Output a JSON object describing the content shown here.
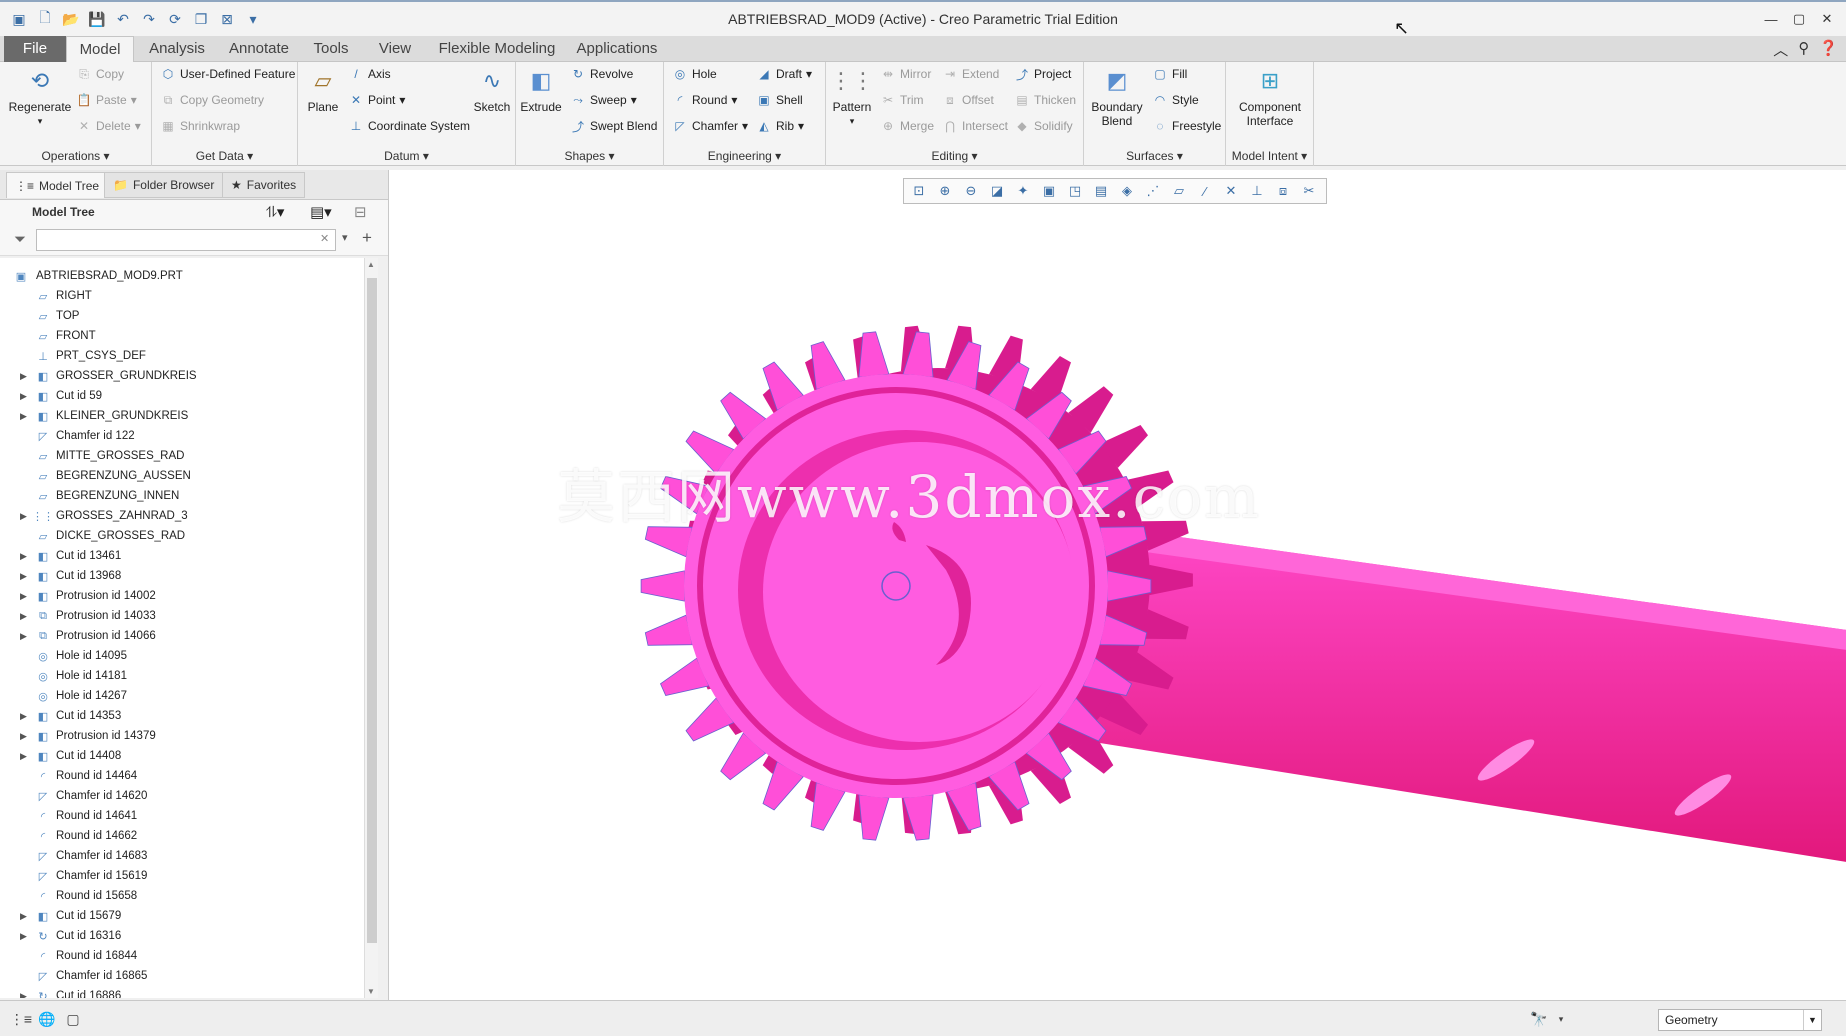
{
  "window": {
    "title": "ABTRIEBSRAD_MOD9 (Active) - Creo Parametric Trial Edition",
    "quick_access_icons": [
      "new-icon",
      "open-icon",
      "save-icon",
      "undo-icon",
      "redo-icon",
      "regenerate-icon",
      "switch-windows-icon",
      "close-window-icon",
      "customize-icon"
    ],
    "controls": [
      "minimize-icon",
      "maximize-icon",
      "close-icon"
    ]
  },
  "tabs": [
    "File",
    "Model",
    "Analysis",
    "Annotate",
    "Tools",
    "View",
    "Flexible Modeling",
    "Applications"
  ],
  "active_tab": "Model",
  "ribbon": {
    "operations": {
      "label": "Operations",
      "regenerate": "Regenerate",
      "copy": "Copy",
      "paste": "Paste",
      "delete": "Delete"
    },
    "get_data": {
      "label": "Get Data",
      "user_defined_feature": "User-Defined Feature",
      "copy_geometry": "Copy Geometry",
      "shrinkwrap": "Shrinkwrap"
    },
    "datum": {
      "label": "Datum",
      "plane": "Plane",
      "axis": "Axis",
      "point": "Point",
      "coordinate_system": "Coordinate System",
      "sketch": "Sketch"
    },
    "shapes": {
      "label": "Shapes",
      "extrude": "Extrude",
      "revolve": "Revolve",
      "sweep": "Sweep",
      "swept_blend": "Swept Blend"
    },
    "engineering": {
      "label": "Engineering",
      "hole": "Hole",
      "round": "Round",
      "chamfer": "Chamfer",
      "draft": "Draft",
      "shell": "Shell",
      "rib": "Rib"
    },
    "editing": {
      "label": "Editing",
      "pattern": "Pattern",
      "mirror": "Mirror",
      "trim": "Trim",
      "merge": "Merge",
      "extend": "Extend",
      "offset": "Offset",
      "intersect": "Intersect",
      "project": "Project",
      "thicken": "Thicken",
      "solidify": "Solidify"
    },
    "surfaces": {
      "label": "Surfaces",
      "boundary_blend": "Boundary Blend",
      "fill": "Fill",
      "style": "Style",
      "freestyle": "Freestyle"
    },
    "model_intent": {
      "label": "Model Intent",
      "component_interface": "Component Interface"
    }
  },
  "nav_tabs": [
    "Model Tree",
    "Folder Browser",
    "Favorites"
  ],
  "model_tree": {
    "title": "Model Tree",
    "search_placeholder": "",
    "items": [
      {
        "label": "ABTRIEBSRAD_MOD9.PRT",
        "icon": "part-icon",
        "expandable": false,
        "root": true
      },
      {
        "label": "RIGHT",
        "icon": "datum-plane-icon",
        "expandable": false
      },
      {
        "label": "TOP",
        "icon": "datum-plane-icon",
        "expandable": false
      },
      {
        "label": "FRONT",
        "icon": "datum-plane-icon",
        "expandable": false
      },
      {
        "label": "PRT_CSYS_DEF",
        "icon": "csys-icon",
        "expandable": false
      },
      {
        "label": "GROSSER_GRUNDKREIS",
        "icon": "extrude-feature-icon",
        "expandable": true
      },
      {
        "label": "Cut id 59",
        "icon": "extrude-feature-icon",
        "expandable": true
      },
      {
        "label": "KLEINER_GRUNDKREIS",
        "icon": "extrude-feature-icon",
        "expandable": true
      },
      {
        "label": "Chamfer id 122",
        "icon": "chamfer-icon",
        "expandable": false
      },
      {
        "label": "MITTE_GROSSES_RAD",
        "icon": "datum-plane-icon",
        "expandable": false
      },
      {
        "label": "BEGRENZUNG_AUSSEN",
        "icon": "datum-plane-icon",
        "expandable": false
      },
      {
        "label": "BEGRENZUNG_INNEN",
        "icon": "datum-plane-icon",
        "expandable": false
      },
      {
        "label": "GROSSES_ZAHNRAD_3",
        "icon": "pattern-icon",
        "expandable": true
      },
      {
        "label": "DICKE_GROSSES_RAD",
        "icon": "datum-plane-icon",
        "expandable": false
      },
      {
        "label": "Cut id 13461",
        "icon": "extrude-feature-icon",
        "expandable": true
      },
      {
        "label": "Cut id 13968",
        "icon": "extrude-feature-icon",
        "expandable": true
      },
      {
        "label": "Protrusion id 14002",
        "icon": "extrude-feature-icon",
        "expandable": true
      },
      {
        "label": "Protrusion id 14033",
        "icon": "group-feature-icon",
        "expandable": true
      },
      {
        "label": "Protrusion id 14066",
        "icon": "group-feature-icon",
        "expandable": true
      },
      {
        "label": "Hole id 14095",
        "icon": "hole-icon",
        "expandable": false
      },
      {
        "label": "Hole id 14181",
        "icon": "hole-icon",
        "expandable": false
      },
      {
        "label": "Hole id 14267",
        "icon": "hole-icon",
        "expandable": false
      },
      {
        "label": "Cut id 14353",
        "icon": "extrude-feature-icon",
        "expandable": true
      },
      {
        "label": "Protrusion id 14379",
        "icon": "extrude-feature-icon",
        "expandable": true
      },
      {
        "label": "Cut id 14408",
        "icon": "extrude-feature-icon",
        "expandable": true
      },
      {
        "label": "Round id 14464",
        "icon": "round-icon",
        "expandable": false
      },
      {
        "label": "Chamfer id 14620",
        "icon": "chamfer-icon",
        "expandable": false
      },
      {
        "label": "Round id 14641",
        "icon": "round-icon",
        "expandable": false
      },
      {
        "label": "Round id 14662",
        "icon": "round-icon",
        "expandable": false
      },
      {
        "label": "Chamfer id 14683",
        "icon": "chamfer-icon",
        "expandable": false
      },
      {
        "label": "Chamfer id 15619",
        "icon": "chamfer-icon",
        "expandable": false
      },
      {
        "label": "Round id 15658",
        "icon": "round-icon",
        "expandable": false
      },
      {
        "label": "Cut id 15679",
        "icon": "extrude-feature-icon",
        "expandable": true
      },
      {
        "label": "Cut id 16316",
        "icon": "revolve-feature-icon",
        "expandable": true
      },
      {
        "label": "Round id 16844",
        "icon": "round-icon",
        "expandable": false
      },
      {
        "label": "Chamfer id 16865",
        "icon": "chamfer-icon",
        "expandable": false
      },
      {
        "label": "Cut id 16886",
        "icon": "revolve-feature-icon",
        "expandable": true
      }
    ]
  },
  "viewport": {
    "watermark": "莫西网www.3dmox.com",
    "model_color": "#ff4fd8",
    "toolbar_icons": [
      "refit-icon",
      "zoom-in-icon",
      "zoom-out-icon",
      "repaint-icon",
      "spin-center-icon",
      "display-style-icon",
      "saved-orientations-icon",
      "view-manager-icon",
      "perspective-icon",
      "datum-display-filters-icon",
      "plane-display-icon",
      "axis-display-icon",
      "point-display-icon",
      "csys-display-icon",
      "annotation-display-icon",
      "spin-icon"
    ]
  },
  "statusbar": {
    "filter_value": "Geometry"
  }
}
